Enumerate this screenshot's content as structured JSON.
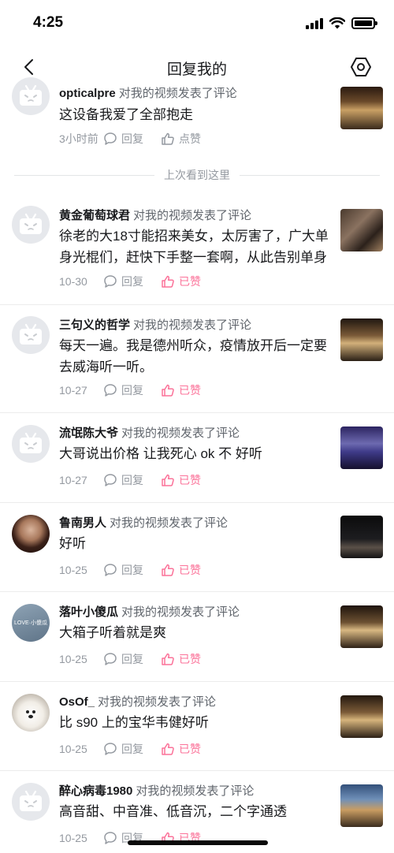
{
  "status_bar": {
    "time": "4:25"
  },
  "nav": {
    "title": "回复我的"
  },
  "first_item": {
    "username": "opticalpre",
    "action": "对我的视频发表了评论",
    "content": "这设备我爱了全部抱走",
    "time": "3小时前",
    "reply_label": "回复",
    "like_label": "点赞"
  },
  "divider": {
    "label": "上次看到这里"
  },
  "items": [
    {
      "username": "黄金葡萄球君",
      "action": "对我的视频发表了评论",
      "content": "徐老的大18寸能招来美女，太厉害了，广大单身光棍们，赶快下手整一套啊，从此告别单身",
      "date": "10-30",
      "reply_label": "回复",
      "like_label": "已赞",
      "avatar": "default-avatar"
    },
    {
      "username": "三句义的哲学",
      "action": "对我的视频发表了评论",
      "content": "每天一遍。我是德州听众，疫情放开后一定要去威海听一听。",
      "date": "10-27",
      "reply_label": "回复",
      "like_label": "已赞",
      "avatar": "default-avatar"
    },
    {
      "username": "流氓陈大爷",
      "action": "对我的视频发表了评论",
      "content": "大哥说出价格  让我死心 ok 不  好听",
      "date": "10-27",
      "reply_label": "回复",
      "like_label": "已赞",
      "avatar": "default-avatar"
    },
    {
      "username": "鲁南男人",
      "action": "对我的视频发表了评论",
      "content": "好听",
      "date": "10-25",
      "reply_label": "回复",
      "like_label": "已赞",
      "avatar": "photo-avatar"
    },
    {
      "username": "落叶小傻瓜",
      "action": "对我的视频发表了评论",
      "content": "大箱子听着就是爽",
      "date": "10-25",
      "reply_label": "回复",
      "like_label": "已赞",
      "avatar": "love-avatar",
      "avatar_text": "LOVE·小傻瓜"
    },
    {
      "username": "OsOf_",
      "action": "对我的视频发表了评论",
      "content": "比 s90 上的宝华韦健好听",
      "date": "10-25",
      "reply_label": "回复",
      "like_label": "已赞",
      "avatar": "dog-avatar"
    },
    {
      "username": "醉心病毒1980",
      "action": "对我的视频发表了评论",
      "content": "高音甜、中音准、低音沉，二个字通透",
      "date": "10-25",
      "reply_label": "回复",
      "like_label": "已赞",
      "avatar": "default-avatar"
    }
  ],
  "colors": {
    "accent": "#fb7299",
    "secondary_text": "#9499a0",
    "primary_text": "#18191c"
  },
  "icons": [
    "back-arrow-icon",
    "settings-hexagon-icon",
    "comment-bubble-icon",
    "thumb-up-icon",
    "tv-mascot-icon"
  ]
}
